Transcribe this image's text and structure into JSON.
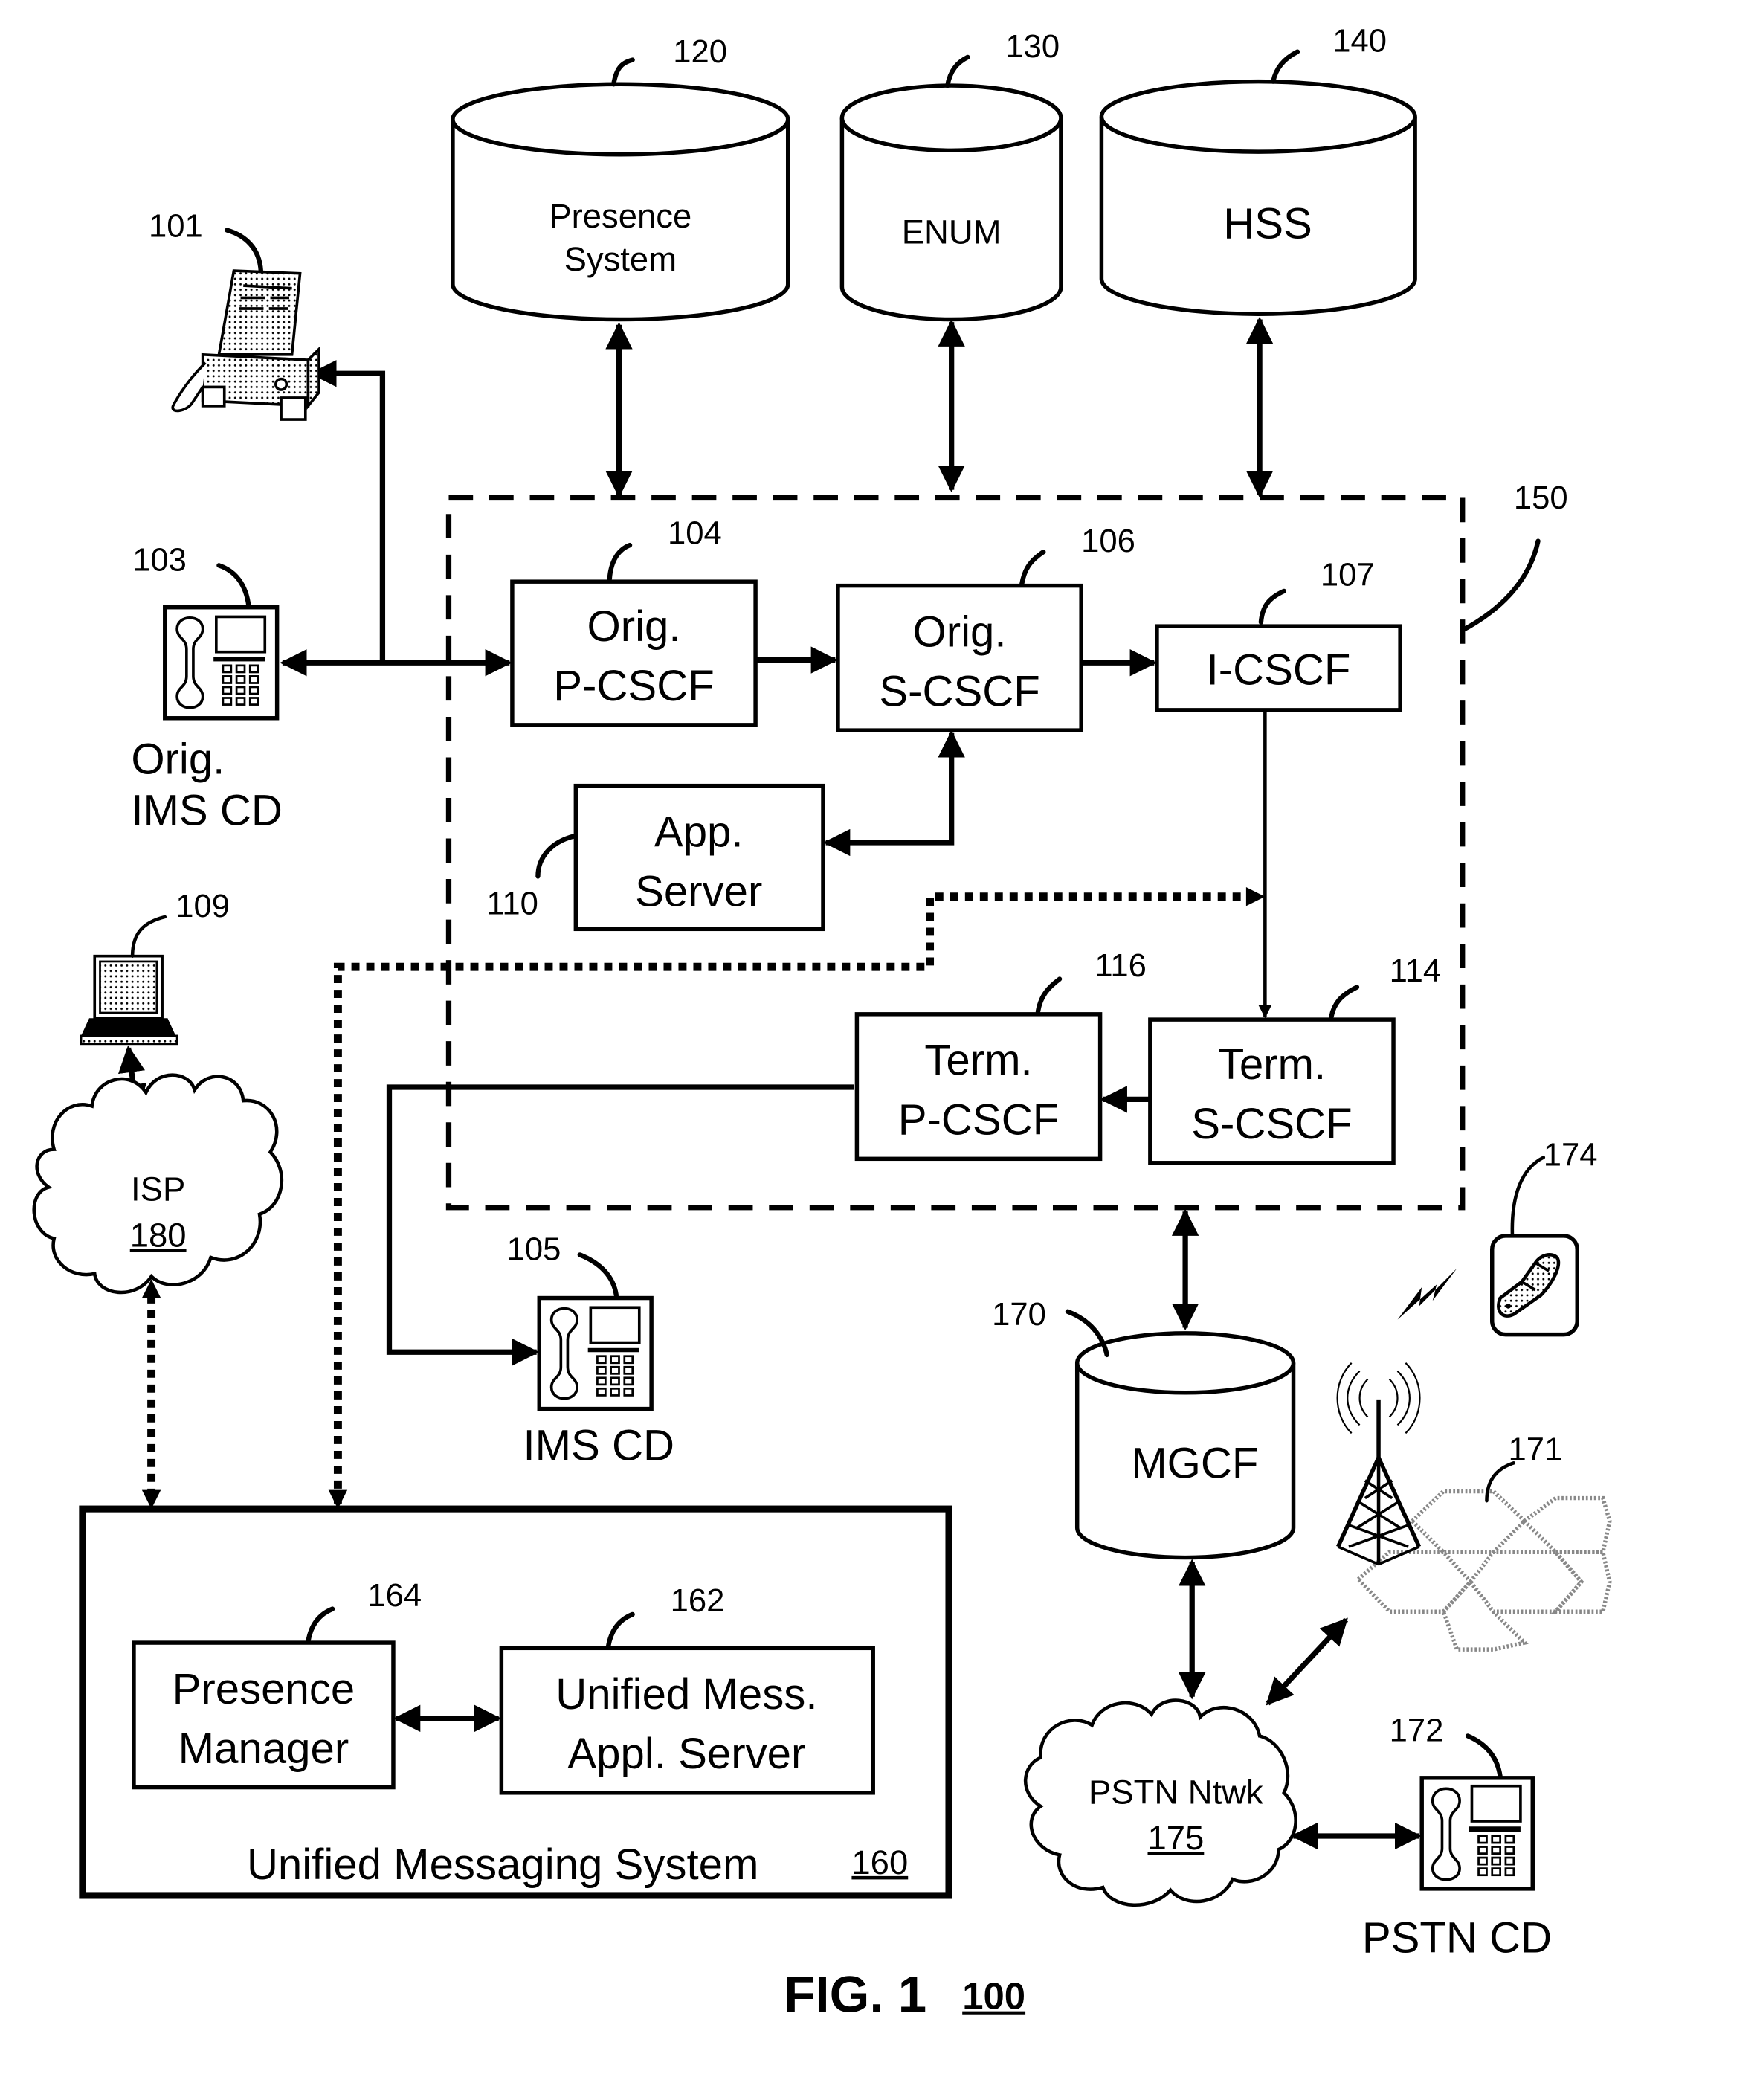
{
  "figure": {
    "title": "FIG. 1",
    "ref": "100"
  },
  "databases": {
    "presence_system": {
      "ref": "120",
      "line1": "Presence",
      "line2": "System"
    },
    "enum": {
      "ref": "130",
      "label": "ENUM"
    },
    "hss": {
      "ref": "140",
      "label": "HSS"
    },
    "mgcf": {
      "ref": "170",
      "label": "MGCF"
    }
  },
  "ims_network": {
    "ref": "150"
  },
  "nodes": {
    "orig_p_cscf": {
      "ref": "104",
      "line1": "Orig.",
      "line2": "P-CSCF"
    },
    "orig_s_cscf": {
      "ref": "106",
      "line1": "Orig.",
      "line2": "S-CSCF"
    },
    "i_cscf": {
      "ref": "107",
      "label": "I-CSCF"
    },
    "app_server": {
      "ref": "110",
      "line1": "App.",
      "line2": "Server"
    },
    "term_p_cscf": {
      "ref": "116",
      "line1": "Term.",
      "line2": "P-CSCF"
    },
    "term_s_cscf": {
      "ref": "114",
      "line1": "Term.",
      "line2": "S-CSCF"
    }
  },
  "devices": {
    "fax": {
      "ref": "101",
      "icon": "fax-icon"
    },
    "orig_ims_cd": {
      "ref": "103",
      "line1": "Orig.",
      "line2": "IMS CD",
      "icon": "desk-phone-icon"
    },
    "laptop": {
      "ref": "109",
      "icon": "laptop-icon"
    },
    "ims_cd": {
      "ref": "105",
      "label": "IMS CD",
      "icon": "desk-phone-icon"
    },
    "mobile": {
      "ref": "174",
      "icon": "mobile-phone-icon"
    },
    "cell_tower": {
      "ref": "171",
      "icon": "cell-tower-icon"
    },
    "pstn_cd": {
      "ref": "172",
      "label": "PSTN CD",
      "icon": "desk-phone-icon"
    }
  },
  "clouds": {
    "isp": {
      "label": "ISP",
      "ref": "180"
    },
    "pstn": {
      "label": "PSTN Ntwk",
      "ref": "175"
    }
  },
  "ums": {
    "title": "Unified Messaging System",
    "ref": "160",
    "presence_manager": {
      "ref": "164",
      "line1": "Presence",
      "line2": "Manager"
    },
    "ums_app_server": {
      "ref": "162",
      "line1": "Unified Mess.",
      "line2": "Appl. Server"
    }
  }
}
